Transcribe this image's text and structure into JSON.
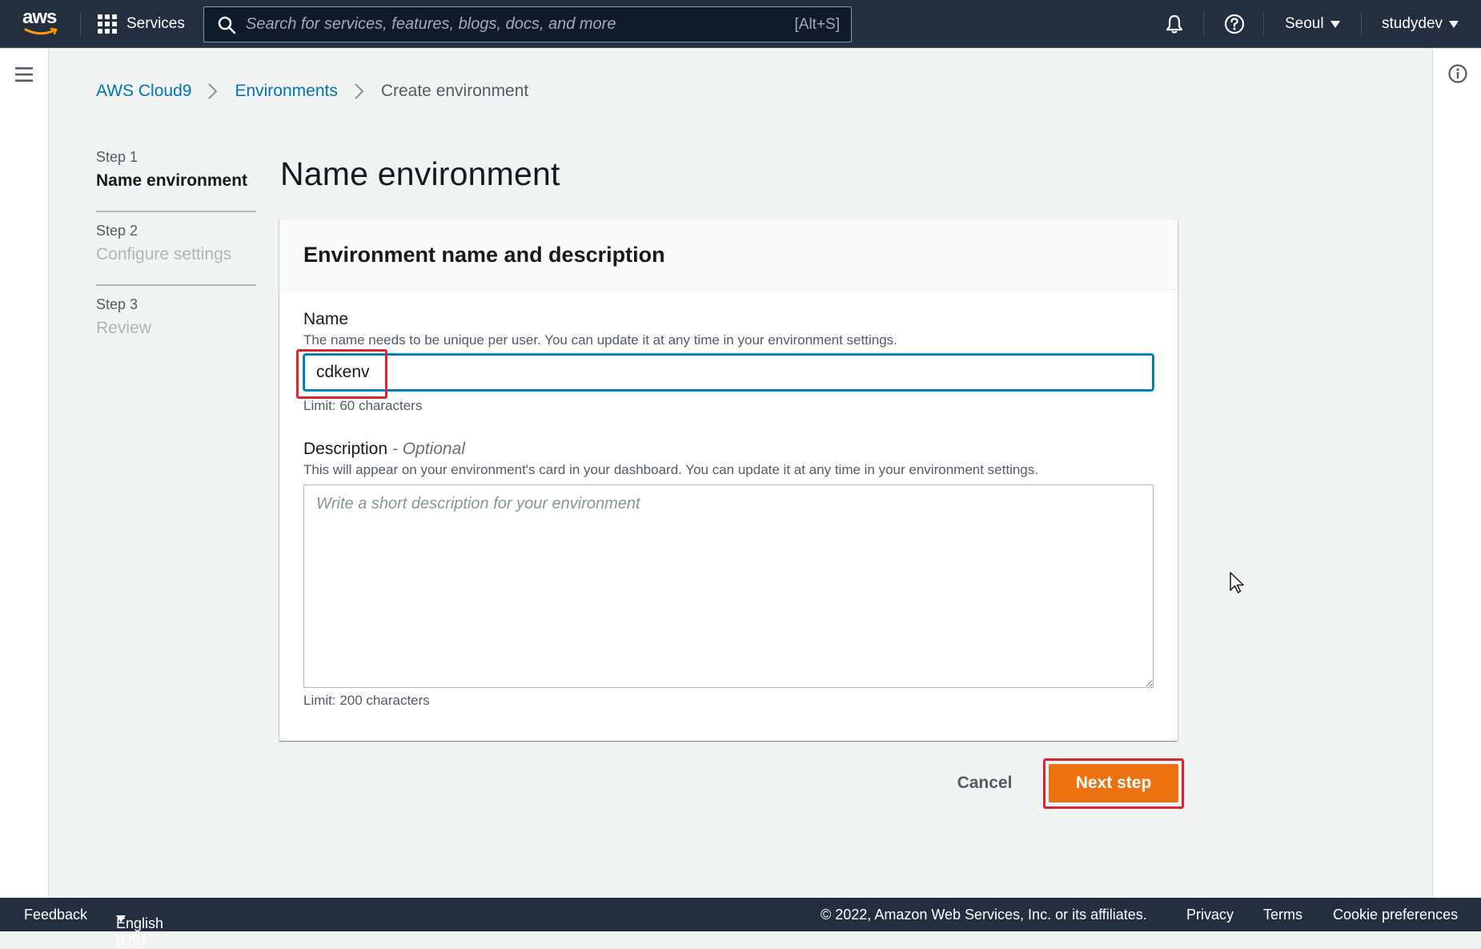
{
  "topnav": {
    "logo_text": "aws",
    "services_label": "Services",
    "search_placeholder": "Search for services, features, blogs, docs, and more",
    "search_shortcut": "[Alt+S]",
    "region": "Seoul",
    "account": "studydev",
    "icons": [
      "grid-icon",
      "search-icon",
      "bell-icon",
      "help-icon",
      "caret-down-icon"
    ]
  },
  "breadcrumb": {
    "items": [
      "AWS Cloud9",
      "Environments",
      "Create environment"
    ]
  },
  "steps": [
    {
      "number": "Step 1",
      "title": "Name environment",
      "state": "active"
    },
    {
      "number": "Step 2",
      "title": "Configure settings",
      "state": "disabled"
    },
    {
      "number": "Step 3",
      "title": "Review",
      "state": "disabled"
    }
  ],
  "main": {
    "title": "Name environment",
    "panel": {
      "heading": "Environment name and description",
      "name": {
        "label": "Name",
        "description": "The name needs to be unique per user. You can update it at any time in your environment settings.",
        "value": "cdkenv",
        "constraint": "Limit: 60 characters"
      },
      "description": {
        "label": "Description",
        "optional_tag": "- Optional",
        "description": "This will appear on your environment's card in your dashboard. You can update it at any time in your environment settings.",
        "placeholder": "Write a short description for your environment",
        "value": "",
        "constraint": "Limit: 200 characters"
      }
    },
    "actions": {
      "cancel_label": "Cancel",
      "next_label": "Next step"
    }
  },
  "footer": {
    "feedback": "Feedback",
    "language": "English (US)",
    "copyright": "© 2022, Amazon Web Services, Inc. or its affiliates.",
    "privacy": "Privacy",
    "terms": "Terms",
    "cookie": "Cookie preferences"
  },
  "colors": {
    "nav_bg": "#232f3e",
    "link": "#0073bb",
    "primary_button": "#ec7211",
    "highlight": "#e0242f"
  }
}
